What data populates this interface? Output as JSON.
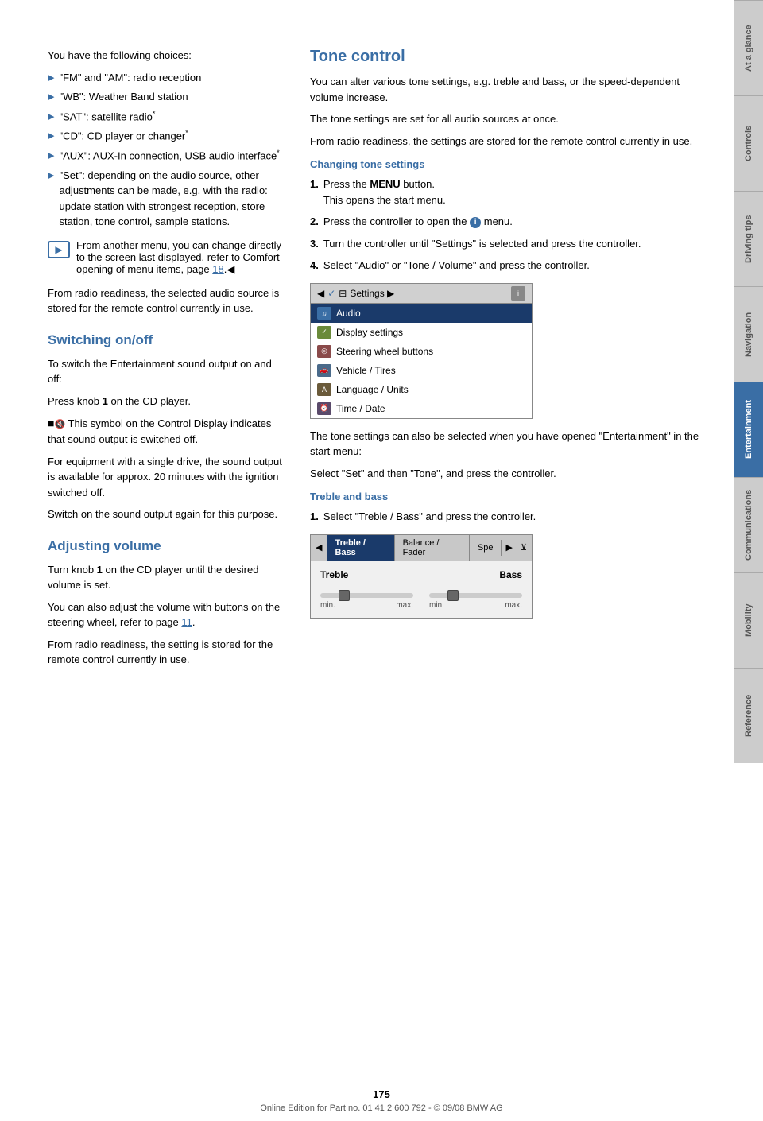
{
  "page": {
    "number": "175",
    "footer_text": "Online Edition for Part no. 01 41 2 600 792 - © 09/08 BMW AG"
  },
  "sidebar": {
    "tabs": [
      {
        "id": "at-a-glance",
        "label": "At a glance",
        "active": false
      },
      {
        "id": "controls",
        "label": "Controls",
        "active": false
      },
      {
        "id": "driving-tips",
        "label": "Driving tips",
        "active": false
      },
      {
        "id": "navigation",
        "label": "Navigation",
        "active": false
      },
      {
        "id": "entertainment",
        "label": "Entertainment",
        "active": true
      },
      {
        "id": "communications",
        "label": "Communications",
        "active": false
      },
      {
        "id": "mobility",
        "label": "Mobility",
        "active": false
      },
      {
        "id": "reference",
        "label": "Reference",
        "active": false
      }
    ]
  },
  "left_column": {
    "intro_text": "You have the following choices:",
    "bullets": [
      {
        "text": "\"FM\" and \"AM\": radio reception"
      },
      {
        "text": "\"WB\": Weather Band station"
      },
      {
        "text": "\"SAT\": satellite radio*"
      },
      {
        "text": "\"CD\": CD player or changer*"
      },
      {
        "text": "\"AUX\": AUX-In connection, USB audio interface*"
      },
      {
        "text": "\"Set\": depending on the audio source, other adjustments can be made, e.g. with the radio: update station with strongest reception, store station, tone control, sample stations."
      }
    ],
    "note_text": "From another menu, you can change directly to the screen last displayed, refer to Comfort opening of menu items, page 18.",
    "radio_readiness_text": "From radio readiness, the selected audio source is stored for the remote control currently in use.",
    "switching_section": {
      "heading": "Switching on/off",
      "para1": "To switch the Entertainment sound output on and off:",
      "para2": "Press knob 1 on the CD player.",
      "para3": "This symbol on the Control Display indicates that sound output is switched off.",
      "para4": "For equipment with a single drive, the sound output is available for approx. 20 minutes with the ignition switched off.",
      "para5": "Switch on the sound output again for this purpose."
    },
    "adjusting_section": {
      "heading": "Adjusting volume",
      "para1": "Turn knob 1 on the CD player until the desired volume is set.",
      "para2": "You can also adjust the volume with buttons on the steering wheel, refer to page 11.",
      "para3": "From radio readiness, the setting is stored for the remote control currently in use."
    }
  },
  "right_column": {
    "tone_section": {
      "heading": "Tone control",
      "para1": "You can alter various tone settings, e.g. treble and bass, or the speed-dependent volume increase.",
      "para2": "The tone settings are set for all audio sources at once.",
      "para3": "From radio readiness, the settings are stored for the remote control currently in use.",
      "changing_tone": {
        "heading": "Changing tone settings",
        "steps": [
          {
            "num": "1.",
            "text": "Press the MENU button.\nThis opens the start menu."
          },
          {
            "num": "2.",
            "text": "Press the controller to open the i menu."
          },
          {
            "num": "3.",
            "text": "Turn the controller until \"Settings\" is selected and press the controller."
          },
          {
            "num": "4.",
            "text": "Select \"Audio\" or \"Tone / Volume\" and press the controller."
          }
        ]
      },
      "menu_items": [
        {
          "label": "Settings",
          "type": "header"
        },
        {
          "label": "Audio",
          "type": "selected",
          "icon": "audio"
        },
        {
          "label": "Display settings",
          "type": "normal",
          "icon": "display"
        },
        {
          "label": "Steering wheel buttons",
          "type": "normal",
          "icon": "steering"
        },
        {
          "label": "Vehicle / Tires",
          "type": "normal",
          "icon": "vehicle"
        },
        {
          "label": "Language / Units",
          "type": "normal",
          "icon": "language"
        },
        {
          "label": "Time / Date",
          "type": "normal",
          "icon": "time"
        }
      ],
      "after_menu_text1": "The tone settings can also be selected when you have opened \"Entertainment\" in the start menu:",
      "after_menu_text2": "Select \"Set\" and then \"Tone\", and press the controller.",
      "treble_bass": {
        "heading": "Treble and bass",
        "step1": "Select \"Treble / Bass\" and press the controller.",
        "tabs": [
          "Treble / Bass",
          "Balance / Fader",
          "Spe",
          ""
        ],
        "labels_left": [
          "Treble",
          "Bass"
        ],
        "slider_left_min": "min.",
        "slider_left_max": "max.",
        "slider_right_min": "min.",
        "slider_right_max": "max."
      }
    }
  }
}
